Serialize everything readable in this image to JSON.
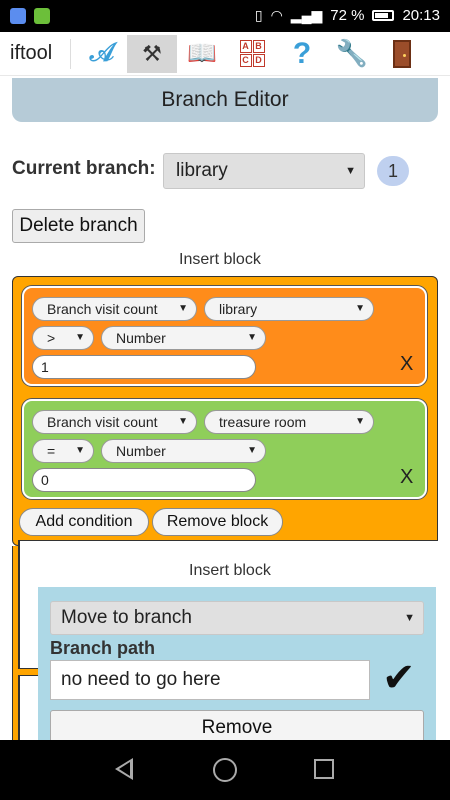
{
  "status": {
    "battery": "72 %",
    "time": "20:13"
  },
  "toolbar": {
    "brand": "iftool",
    "icons": [
      "a-tool-icon",
      "tools-icon",
      "book-icon",
      "abcd-icon",
      "help-icon",
      "wrench-icon",
      "door-icon"
    ],
    "abcd_letters": [
      "A",
      "B",
      "C",
      "D"
    ],
    "help_glyph": "?"
  },
  "header": {
    "title": "Branch Editor"
  },
  "current_branch": {
    "label": "Current branch:",
    "value": "library",
    "count": "1"
  },
  "buttons": {
    "delete_branch": "Delete branch",
    "add_condition": "Add condition",
    "remove_block": "Remove block",
    "remove": "Remove"
  },
  "captions": {
    "insert_block_1": "Insert block",
    "insert_block_2": "Insert block"
  },
  "conditions": [
    {
      "field": "Branch visit count",
      "target": "library",
      "operator": ">",
      "type": "Number",
      "value": "1",
      "remove": "X",
      "color": "#ff8c1a"
    },
    {
      "field": "Branch visit count",
      "target": "treasure room",
      "operator": "=",
      "type": "Number",
      "value": "0",
      "remove": "X",
      "color": "#8fce5a"
    }
  ],
  "action": {
    "type": "Move to branch",
    "path_label": "Branch path",
    "path_value": "no need to go here",
    "confirm": "✔"
  },
  "colors": {
    "block_orange": "#ffa500",
    "action_blue": "#add8e6",
    "banner": "#b6cbd7"
  }
}
